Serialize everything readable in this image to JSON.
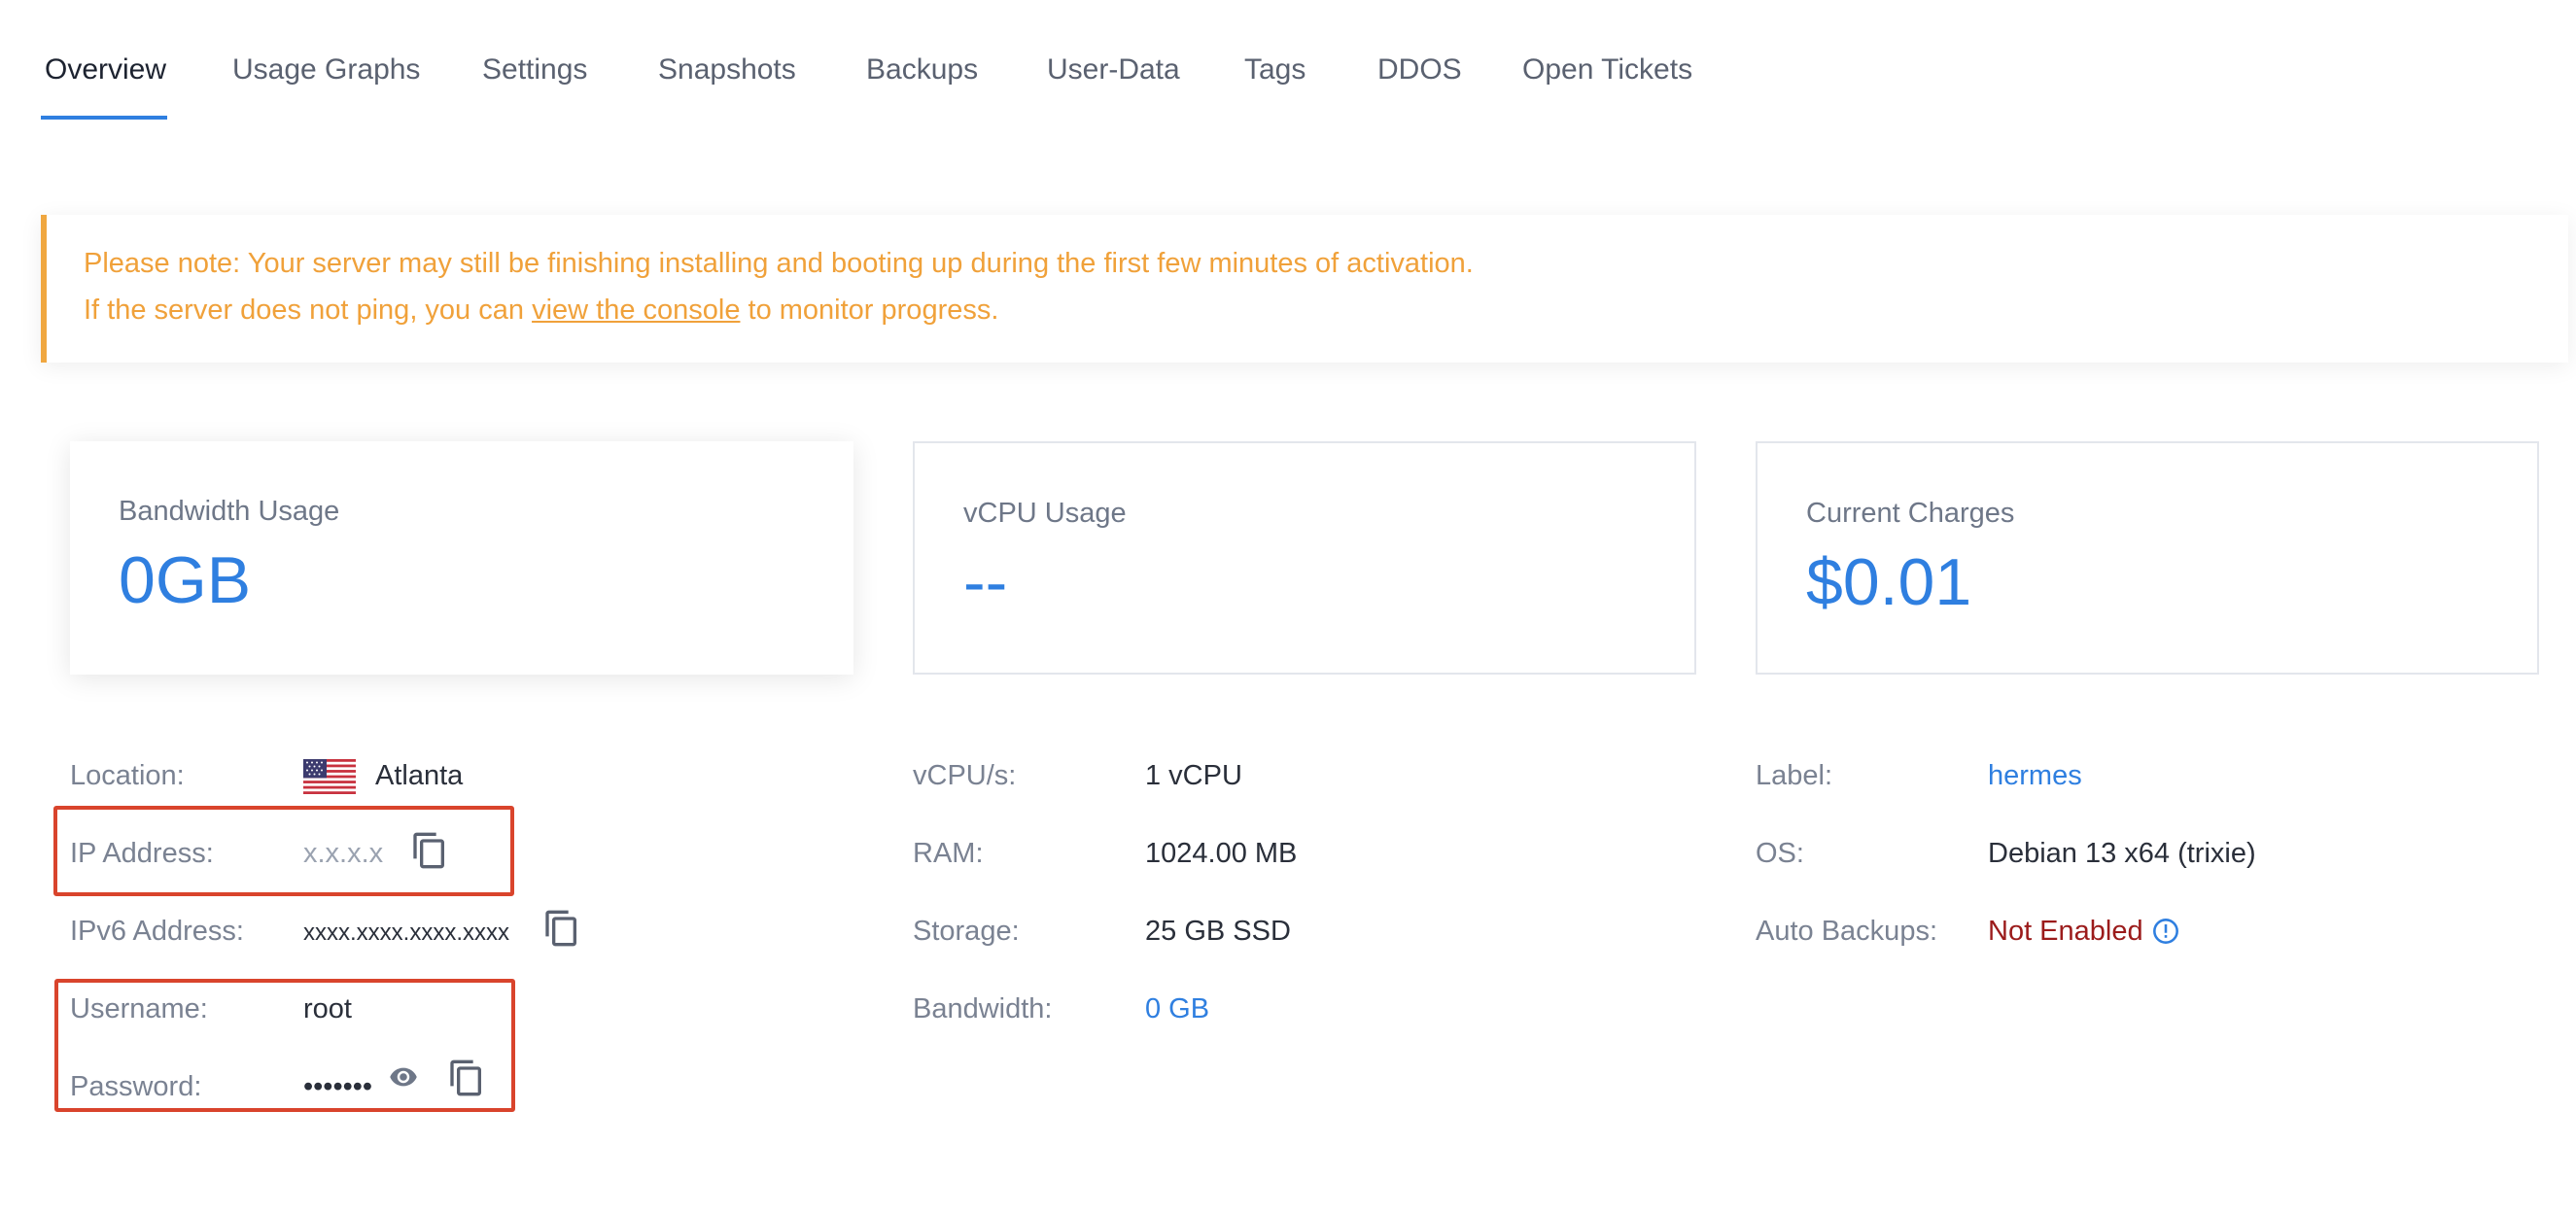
{
  "tabs": [
    {
      "label": "Overview",
      "active": true
    },
    {
      "label": "Usage Graphs"
    },
    {
      "label": "Settings"
    },
    {
      "label": "Snapshots"
    },
    {
      "label": "Backups"
    },
    {
      "label": "User-Data"
    },
    {
      "label": "Tags"
    },
    {
      "label": "DDOS"
    },
    {
      "label": "Open Tickets"
    }
  ],
  "notice": {
    "line1": "Please note: Your server may still be finishing installing and booting up during the first few minutes of activation.",
    "line2_before": "If the server does not ping, you can ",
    "line2_link": "view the console",
    "line2_after": " to monitor progress."
  },
  "cards": {
    "bandwidth": {
      "title": "Bandwidth Usage",
      "value": "0GB"
    },
    "vcpu": {
      "title": "vCPU Usage",
      "value": "--"
    },
    "charges": {
      "title": "Current Charges",
      "value": "$0.01"
    }
  },
  "server": {
    "location_label": "Location:",
    "location_value": "Atlanta",
    "ip_label": "IP Address:",
    "ip_value": "x.x.x.x",
    "ipv6_label": "IPv6 Address:",
    "ipv6_value": "xxxx.xxxx.xxxx.xxxx",
    "username_label": "Username:",
    "username_value": "root",
    "password_label": "Password:",
    "password_value": "•••••••"
  },
  "specs": {
    "vcpu_label": "vCPU/s:",
    "vcpu_value": "1 vCPU",
    "ram_label": "RAM:",
    "ram_value": "1024.00 MB",
    "storage_label": "Storage:",
    "storage_value": "25 GB SSD",
    "bandwidth_label": "Bandwidth:",
    "bandwidth_value": "0 GB"
  },
  "meta": {
    "label_label": "Label:",
    "label_value": "hermes",
    "os_label": "OS:",
    "os_value": "Debian 13 x64 (trixie)",
    "backups_label": "Auto Backups:",
    "backups_value": "Not Enabled"
  },
  "icons": {
    "copy": "copy-icon",
    "eye": "eye-icon",
    "info": "info-icon",
    "flag": "us-flag-icon"
  },
  "colors": {
    "accent": "#2f7fe0",
    "warning": "#f0a13a",
    "danger": "#9b1b1b",
    "highlight": "#d9442c"
  }
}
